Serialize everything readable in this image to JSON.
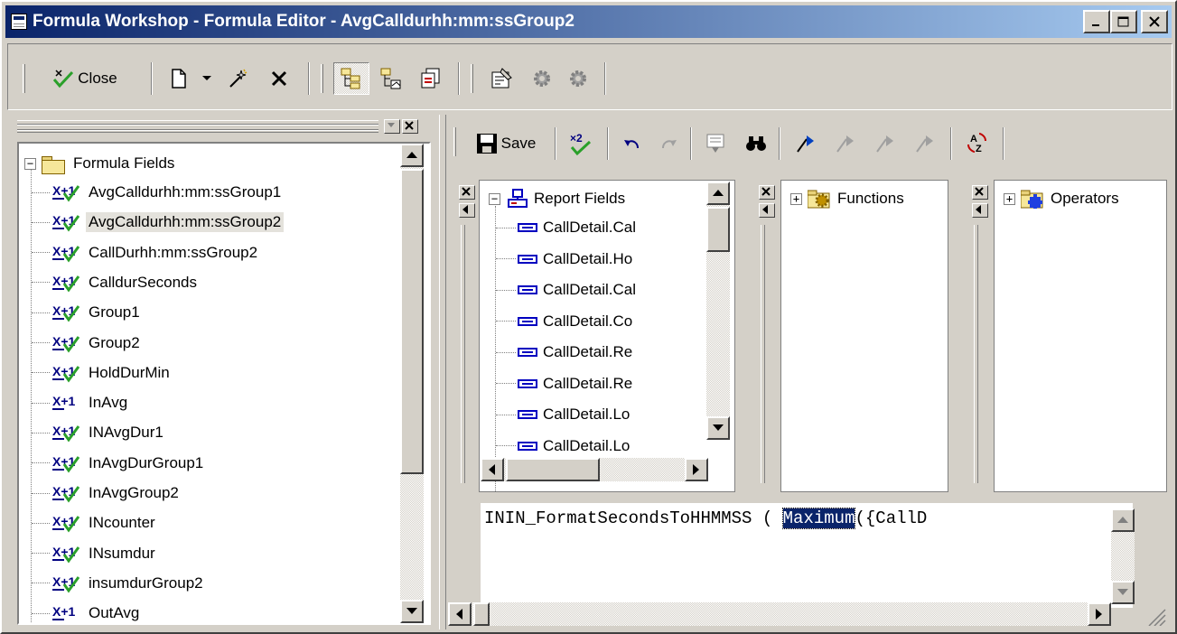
{
  "window": {
    "title": "Formula Workshop - Formula Editor - AvgCalldurhh:mm:ssGroup2",
    "minimize": "_",
    "maximize": "□",
    "close": "✕"
  },
  "toolbar": {
    "close_label": "Close",
    "icons": [
      "close-check-icon",
      "new-document-icon",
      "dropdown-arrow-icon",
      "magic-wand-icon",
      "delete-x-icon",
      "toggle-tree-icon",
      "show-fields-icon",
      "copy-formula-icon",
      "properties-icon",
      "gear-icon",
      "gear-icon"
    ]
  },
  "formula_tree": {
    "root_label": "Formula Fields",
    "items": [
      {
        "label": "AvgCalldurhh:mm:ssGroup1",
        "checked": true,
        "selected": false
      },
      {
        "label": "AvgCalldurhh:mm:ssGroup2",
        "checked": true,
        "selected": true
      },
      {
        "label": "CallDurhh:mm:ssGroup2",
        "checked": true,
        "selected": false
      },
      {
        "label": "CalldurSeconds",
        "checked": true,
        "selected": false
      },
      {
        "label": "Group1",
        "checked": true,
        "selected": false
      },
      {
        "label": "Group2",
        "checked": true,
        "selected": false
      },
      {
        "label": "HoldDurMin",
        "checked": true,
        "selected": false
      },
      {
        "label": "InAvg",
        "checked": false,
        "selected": false
      },
      {
        "label": "INAvgDur1",
        "checked": true,
        "selected": false
      },
      {
        "label": "InAvgDurGroup1",
        "checked": true,
        "selected": false
      },
      {
        "label": "InAvgGroup2",
        "checked": true,
        "selected": false
      },
      {
        "label": "INcounter",
        "checked": true,
        "selected": false
      },
      {
        "label": "INsumdur",
        "checked": true,
        "selected": false
      },
      {
        "label": "insumdurGroup2",
        "checked": true,
        "selected": false
      },
      {
        "label": "OutAvg",
        "checked": false,
        "selected": false
      }
    ]
  },
  "editor_toolbar": {
    "save_label": "Save"
  },
  "report_fields": {
    "root_label": "Report Fields",
    "items": [
      "CallDetail.Cal",
      "CallDetail.Ho",
      "CallDetail.Cal",
      "CallDetail.Co",
      "CallDetail.Re",
      "CallDetail.Re",
      "CallDetail.Lo",
      "CallDetail.Lo"
    ]
  },
  "functions": {
    "root_label": "Functions"
  },
  "operators": {
    "root_label": "Operators"
  },
  "formula_text": {
    "before": "ININ_FormatSecondsToHHMMSS ( ",
    "highlight": "Maximum",
    "after": "({CallD"
  }
}
